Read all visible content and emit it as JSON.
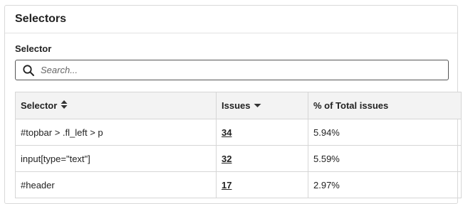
{
  "panel": {
    "title": "Selectors"
  },
  "filter": {
    "label": "Selector",
    "placeholder": "Search...",
    "value": ""
  },
  "table": {
    "headers": {
      "selector": "Selector",
      "issues": "Issues",
      "percent": "% of Total issues"
    },
    "sort": {
      "selector": "sortable-icon",
      "issues": "sort-desc-icon"
    },
    "rows": [
      {
        "selector": "#topbar > .fl_left > p",
        "issues": "34",
        "percent": "5.94%"
      },
      {
        "selector": "input[type=\"text\"]",
        "issues": "32",
        "percent": "5.59%"
      },
      {
        "selector": "#header",
        "issues": "17",
        "percent": "2.97%"
      }
    ]
  }
}
